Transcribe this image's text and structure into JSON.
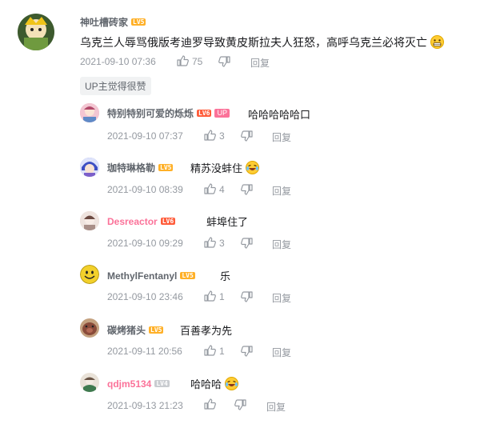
{
  "main_comment": {
    "username": "神吐槽砖家",
    "level": "LV5",
    "text": "乌克兰人辱骂俄版考迪罗导致黄皮斯拉夫人狂怒，高呼乌克兰必将灭亡",
    "emoji": "grin-emoji",
    "time": "2021-09-10 07:36",
    "likes": "75",
    "reply_label": "回复",
    "up_liked": "UP主觉得很赞"
  },
  "replies": [
    {
      "username": "特别特别可爱的烁烁",
      "level": "LV6",
      "up": "UP",
      "text": "哈哈哈哈哈口",
      "time": "2021-09-10 07:37",
      "likes": "3",
      "reply_label": "回复",
      "avatar_color": "#e8a3b4"
    },
    {
      "username": "珈特琳格勒",
      "level": "LV5",
      "text": "精苏没蚌住",
      "emoji": "laugh-cry-emoji",
      "time": "2021-09-10 08:39",
      "likes": "4",
      "reply_label": "回复",
      "avatar_color": "#5a6bd6"
    },
    {
      "username": "Desreactor",
      "level": "LV6",
      "text": "蚌埠住了",
      "time": "2021-09-10 09:29",
      "likes": "3",
      "reply_label": "回复",
      "avatar_color": "#d8c7c1"
    },
    {
      "username": "MethylFentanyl",
      "level": "LV5",
      "text": "乐",
      "time": "2021-09-10 23:46",
      "likes": "1",
      "reply_label": "回复",
      "avatar_color": "#f2d02b"
    },
    {
      "username": "碳烤猪头",
      "level": "LV5",
      "text": "百善孝为先",
      "time": "2021-09-11 20:56",
      "likes": "1",
      "reply_label": "回复",
      "avatar_color": "#8a4b3a"
    },
    {
      "username": "qdjm5134",
      "level": "LV4",
      "text": "哈哈哈",
      "emoji": "laugh-cry-emoji",
      "time": "2021-09-13 21:23",
      "likes": "",
      "reply_label": "回复",
      "avatar_color": "#b9a99a"
    }
  ],
  "colors": {
    "pink_name": "#fb7299",
    "meta": "#9499a0",
    "level5": "#ffb027",
    "level6": "#ff5c3a"
  }
}
